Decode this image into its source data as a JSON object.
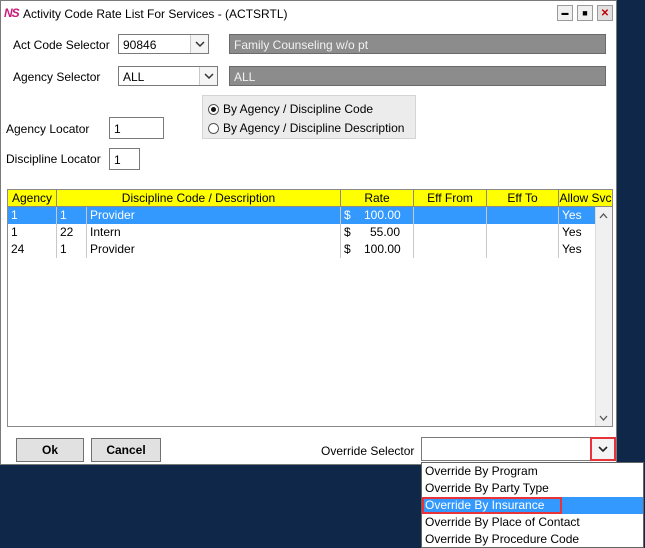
{
  "window": {
    "logo": "NS",
    "title": "Activity Code Rate List For Services - (ACTSRTL)"
  },
  "window_buttons": {
    "minimize": "▬",
    "maximize": "■",
    "close": "✕"
  },
  "act_code": {
    "label": "Act Code Selector",
    "value": "90846",
    "description": "Family Counseling w/o pt"
  },
  "agency_selector": {
    "label": "Agency Selector",
    "value": "ALL",
    "description": "ALL"
  },
  "radio": {
    "opt1": "By Agency / Discipline Code",
    "opt2": "By Agency / Discipline Description",
    "selected": 1
  },
  "agency_locator": {
    "label": "Agency Locator",
    "value": "1"
  },
  "discipline_locator": {
    "label": "Discipline Locator",
    "value": "1"
  },
  "grid": {
    "headers": [
      "Agency",
      "Discipline Code / Description",
      "Rate",
      "Eff From",
      "Eff To",
      "Allow Svc"
    ],
    "rows": [
      {
        "agency": "1",
        "code": "1",
        "desc": "Provider",
        "cur": "$",
        "rate": "100.00",
        "from": "",
        "to": "",
        "allow": "Yes"
      },
      {
        "agency": "1",
        "code": "22",
        "desc": "Intern",
        "cur": "$",
        "rate": "55.00",
        "from": "",
        "to": "",
        "allow": "Yes"
      },
      {
        "agency": "24",
        "code": "1",
        "desc": "Provider",
        "cur": "$",
        "rate": "100.00",
        "from": "",
        "to": "",
        "allow": "Yes"
      }
    ]
  },
  "buttons": {
    "ok": "Ok",
    "cancel": "Cancel"
  },
  "override": {
    "label": "Override Selector",
    "value": "",
    "options": [
      "Override By Program",
      "Override By Party Type",
      "Override By Insurance",
      "Override By Place of Contact",
      "Override By Procedure Code"
    ],
    "highlighted_index": 2
  },
  "colors": {
    "header": "#ffff00",
    "selection": "#3399ff",
    "highlight_outline": "#e8333a",
    "desktop": "#0f2748"
  }
}
